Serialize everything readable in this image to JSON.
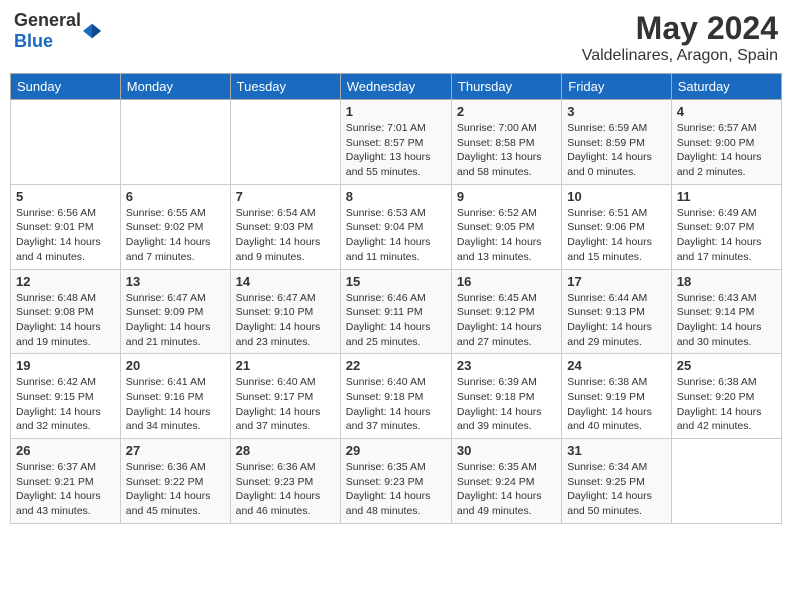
{
  "header": {
    "logo_general": "General",
    "logo_blue": "Blue",
    "title": "May 2024",
    "subtitle": "Valdelinares, Aragon, Spain"
  },
  "calendar": {
    "days_of_week": [
      "Sunday",
      "Monday",
      "Tuesday",
      "Wednesday",
      "Thursday",
      "Friday",
      "Saturday"
    ],
    "weeks": [
      [
        {
          "day": "",
          "info": ""
        },
        {
          "day": "",
          "info": ""
        },
        {
          "day": "",
          "info": ""
        },
        {
          "day": "1",
          "info": "Sunrise: 7:01 AM\nSunset: 8:57 PM\nDaylight: 13 hours\nand 55 minutes."
        },
        {
          "day": "2",
          "info": "Sunrise: 7:00 AM\nSunset: 8:58 PM\nDaylight: 13 hours\nand 58 minutes."
        },
        {
          "day": "3",
          "info": "Sunrise: 6:59 AM\nSunset: 8:59 PM\nDaylight: 14 hours\nand 0 minutes."
        },
        {
          "day": "4",
          "info": "Sunrise: 6:57 AM\nSunset: 9:00 PM\nDaylight: 14 hours\nand 2 minutes."
        }
      ],
      [
        {
          "day": "5",
          "info": "Sunrise: 6:56 AM\nSunset: 9:01 PM\nDaylight: 14 hours\nand 4 minutes."
        },
        {
          "day": "6",
          "info": "Sunrise: 6:55 AM\nSunset: 9:02 PM\nDaylight: 14 hours\nand 7 minutes."
        },
        {
          "day": "7",
          "info": "Sunrise: 6:54 AM\nSunset: 9:03 PM\nDaylight: 14 hours\nand 9 minutes."
        },
        {
          "day": "8",
          "info": "Sunrise: 6:53 AM\nSunset: 9:04 PM\nDaylight: 14 hours\nand 11 minutes."
        },
        {
          "day": "9",
          "info": "Sunrise: 6:52 AM\nSunset: 9:05 PM\nDaylight: 14 hours\nand 13 minutes."
        },
        {
          "day": "10",
          "info": "Sunrise: 6:51 AM\nSunset: 9:06 PM\nDaylight: 14 hours\nand 15 minutes."
        },
        {
          "day": "11",
          "info": "Sunrise: 6:49 AM\nSunset: 9:07 PM\nDaylight: 14 hours\nand 17 minutes."
        }
      ],
      [
        {
          "day": "12",
          "info": "Sunrise: 6:48 AM\nSunset: 9:08 PM\nDaylight: 14 hours\nand 19 minutes."
        },
        {
          "day": "13",
          "info": "Sunrise: 6:47 AM\nSunset: 9:09 PM\nDaylight: 14 hours\nand 21 minutes."
        },
        {
          "day": "14",
          "info": "Sunrise: 6:47 AM\nSunset: 9:10 PM\nDaylight: 14 hours\nand 23 minutes."
        },
        {
          "day": "15",
          "info": "Sunrise: 6:46 AM\nSunset: 9:11 PM\nDaylight: 14 hours\nand 25 minutes."
        },
        {
          "day": "16",
          "info": "Sunrise: 6:45 AM\nSunset: 9:12 PM\nDaylight: 14 hours\nand 27 minutes."
        },
        {
          "day": "17",
          "info": "Sunrise: 6:44 AM\nSunset: 9:13 PM\nDaylight: 14 hours\nand 29 minutes."
        },
        {
          "day": "18",
          "info": "Sunrise: 6:43 AM\nSunset: 9:14 PM\nDaylight: 14 hours\nand 30 minutes."
        }
      ],
      [
        {
          "day": "19",
          "info": "Sunrise: 6:42 AM\nSunset: 9:15 PM\nDaylight: 14 hours\nand 32 minutes."
        },
        {
          "day": "20",
          "info": "Sunrise: 6:41 AM\nSunset: 9:16 PM\nDaylight: 14 hours\nand 34 minutes."
        },
        {
          "day": "21",
          "info": "Sunrise: 6:40 AM\nSunset: 9:17 PM\nDaylight: 14 hours\nand 37 minutes."
        },
        {
          "day": "22",
          "info": "Sunrise: 6:40 AM\nSunset: 9:18 PM\nDaylight: 14 hours\nand 37 minutes."
        },
        {
          "day": "23",
          "info": "Sunrise: 6:39 AM\nSunset: 9:18 PM\nDaylight: 14 hours\nand 39 minutes."
        },
        {
          "day": "24",
          "info": "Sunrise: 6:38 AM\nSunset: 9:19 PM\nDaylight: 14 hours\nand 40 minutes."
        },
        {
          "day": "25",
          "info": "Sunrise: 6:38 AM\nSunset: 9:20 PM\nDaylight: 14 hours\nand 42 minutes."
        }
      ],
      [
        {
          "day": "26",
          "info": "Sunrise: 6:37 AM\nSunset: 9:21 PM\nDaylight: 14 hours\nand 43 minutes."
        },
        {
          "day": "27",
          "info": "Sunrise: 6:36 AM\nSunset: 9:22 PM\nDaylight: 14 hours\nand 45 minutes."
        },
        {
          "day": "28",
          "info": "Sunrise: 6:36 AM\nSunset: 9:23 PM\nDaylight: 14 hours\nand 46 minutes."
        },
        {
          "day": "29",
          "info": "Sunrise: 6:35 AM\nSunset: 9:23 PM\nDaylight: 14 hours\nand 48 minutes."
        },
        {
          "day": "30",
          "info": "Sunrise: 6:35 AM\nSunset: 9:24 PM\nDaylight: 14 hours\nand 49 minutes."
        },
        {
          "day": "31",
          "info": "Sunrise: 6:34 AM\nSunset: 9:25 PM\nDaylight: 14 hours\nand 50 minutes."
        },
        {
          "day": "",
          "info": ""
        }
      ]
    ]
  }
}
